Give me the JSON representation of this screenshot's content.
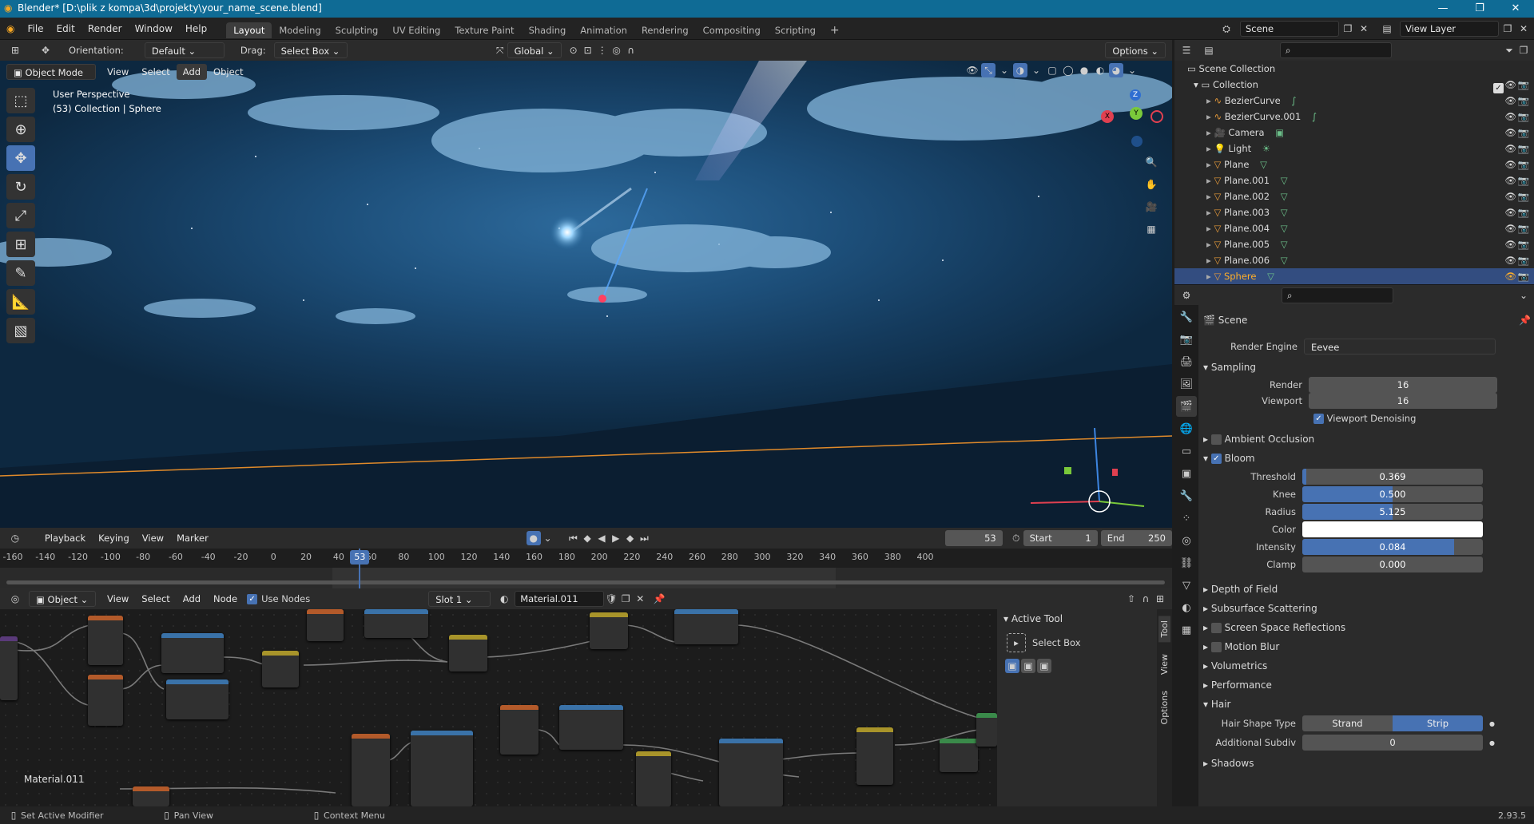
{
  "window": {
    "title": "Blender* [D:\\plik z kompa\\3d\\projekty\\your_name_scene.blend]",
    "min": "—",
    "max": "❐",
    "close": "✕"
  },
  "menu": [
    "File",
    "Edit",
    "Render",
    "Window",
    "Help"
  ],
  "workspaces": [
    "Layout",
    "Modeling",
    "Sculpting",
    "UV Editing",
    "Texture Paint",
    "Shading",
    "Animation",
    "Rendering",
    "Compositing",
    "Scripting"
  ],
  "active_workspace": "Layout",
  "scene_field": "Scene",
  "view_layer_field": "View Layer",
  "viewport": {
    "orientation_label": "Orientation:",
    "orientation_value": "Default",
    "drag_label": "Drag:",
    "drag_value": "Select Box",
    "transform_orientation": "Global",
    "options_label": "Options",
    "mode": "Object Mode",
    "menus": [
      "View",
      "Select",
      "Add",
      "Object"
    ],
    "overlay_line1": "User Perspective",
    "overlay_line2": "(53) Collection | Sphere",
    "gizmo_axes": {
      "x": "X",
      "y": "Y",
      "z": "Z"
    }
  },
  "timeline": {
    "menus": [
      "Playback",
      "Keying",
      "View",
      "Marker"
    ],
    "current_frame": "53",
    "start_label": "Start",
    "start": "1",
    "end_label": "End",
    "end": "250",
    "ticks": [
      "-160",
      "-140",
      "-120",
      "-100",
      "-80",
      "-60",
      "-40",
      "-20",
      "0",
      "20",
      "40",
      "60",
      "80",
      "100",
      "120",
      "140",
      "160",
      "180",
      "200",
      "220",
      "240",
      "260",
      "280",
      "300",
      "320",
      "340",
      "360",
      "380",
      "400"
    ],
    "playhead": 53,
    "range_min": -160,
    "range_max": 400
  },
  "node_editor": {
    "mode": "Object",
    "menus": [
      "View",
      "Select",
      "Add",
      "Node"
    ],
    "use_nodes_label": "Use Nodes",
    "slot": "Slot 1",
    "material": "Material.011",
    "material_label": "Material.011",
    "sidebar": {
      "title": "Active Tool",
      "tool": "Select Box",
      "tabs": [
        "Tool",
        "View",
        "Options"
      ]
    }
  },
  "outliner": {
    "root": "Scene Collection",
    "collection": "Collection",
    "items": [
      {
        "name": "BezierCurve",
        "icon": "curve-icon",
        "selected": false
      },
      {
        "name": "BezierCurve.001",
        "icon": "curve-icon",
        "selected": false
      },
      {
        "name": "Camera",
        "icon": "camera-icon",
        "selected": false
      },
      {
        "name": "Light",
        "icon": "light-icon",
        "selected": false
      },
      {
        "name": "Plane",
        "icon": "mesh-icon",
        "selected": false
      },
      {
        "name": "Plane.001",
        "icon": "mesh-icon",
        "selected": false
      },
      {
        "name": "Plane.002",
        "icon": "mesh-icon",
        "selected": false
      },
      {
        "name": "Plane.003",
        "icon": "mesh-icon",
        "selected": false
      },
      {
        "name": "Plane.004",
        "icon": "mesh-icon",
        "selected": false
      },
      {
        "name": "Plane.005",
        "icon": "mesh-icon",
        "selected": false
      },
      {
        "name": "Plane.006",
        "icon": "mesh-icon",
        "selected": false
      },
      {
        "name": "Sphere",
        "icon": "mesh-icon",
        "selected": true
      }
    ]
  },
  "properties": {
    "context": "Scene",
    "render_engine_label": "Render Engine",
    "render_engine": "Eevee",
    "sampling": {
      "title": "Sampling",
      "render_label": "Render",
      "render": "16",
      "viewport_label": "Viewport",
      "viewport": "16",
      "denoise_label": "Viewport Denoising"
    },
    "ambient_occlusion": "Ambient Occlusion",
    "bloom": {
      "title": "Bloom",
      "threshold_label": "Threshold",
      "threshold": "0.369",
      "knee_label": "Knee",
      "knee": "0.500",
      "radius_label": "Radius",
      "radius": "5.125",
      "color_label": "Color",
      "intensity_label": "Intensity",
      "intensity": "0.084",
      "clamp_label": "Clamp",
      "clamp": "0.000",
      "threshold_fill": 0.02,
      "knee_fill": 0.5,
      "radius_fill": 0.5,
      "intensity_fill": 0.84,
      "clamp_fill": 0
    },
    "sections": [
      "Depth of Field",
      "Subsurface Scattering",
      "Screen Space Reflections",
      "Motion Blur",
      "Volumetrics",
      "Performance"
    ],
    "hair": {
      "title": "Hair",
      "shape_label": "Hair Shape Type",
      "strand": "Strand",
      "strip": "Strip",
      "subdiv_label": "Additional Subdiv",
      "subdiv": "0"
    },
    "shadows": "Shadows"
  },
  "status": {
    "left": "Set Active Modifier",
    "middle": "Pan View",
    "right": "Context Menu",
    "version": "2.93.5"
  },
  "colors": {
    "accent": "#4772b3",
    "selected_text": "#ffaf29",
    "title_bar": "#0f6b95"
  }
}
